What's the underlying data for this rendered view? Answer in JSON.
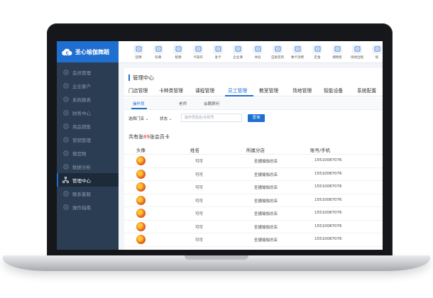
{
  "brand": {
    "name": "圣心瑜伽舞蹈"
  },
  "sidebar": {
    "items": [
      {
        "label": "会员管理",
        "icon": "user-icon",
        "active": false
      },
      {
        "label": "企业客户",
        "icon": "building-icon",
        "active": false
      },
      {
        "label": "系统报表",
        "icon": "report-icon",
        "active": false
      },
      {
        "label": "财务中心",
        "icon": "finance-icon",
        "active": false
      },
      {
        "label": "商品销售",
        "icon": "cart-icon",
        "active": false
      },
      {
        "label": "营销管理",
        "icon": "megaphone-icon",
        "active": false
      },
      {
        "label": "微官网",
        "icon": "globe-icon",
        "active": false
      },
      {
        "label": "数据分析",
        "icon": "chart-icon",
        "active": false
      },
      {
        "label": "管理中心",
        "icon": "network-icon",
        "active": true
      },
      {
        "label": "联系客服",
        "icon": "headset-icon",
        "active": false
      },
      {
        "label": "操作指南",
        "icon": "guide-icon",
        "active": false
      }
    ]
  },
  "toolbar": {
    "items": [
      {
        "label": "团课",
        "icon": "calendar-icon"
      },
      {
        "label": "私教",
        "icon": "person-icon"
      },
      {
        "label": "租课",
        "icon": "book-icon"
      },
      {
        "label": "卡操作",
        "icon": "card-icon"
      },
      {
        "label": "发卡",
        "icon": "issue-card-icon"
      },
      {
        "label": "企业课",
        "icon": "group-icon"
      },
      {
        "label": "体验",
        "icon": "experience-icon"
      },
      {
        "label": "自助签到",
        "icon": "checkin-icon"
      },
      {
        "label": "乘卡消费",
        "icon": "consume-icon"
      },
      {
        "label": "定金",
        "icon": "deposit-icon"
      },
      {
        "label": "储物柜",
        "icon": "locker-icon"
      },
      {
        "label": "场地出租",
        "icon": "venue-icon"
      },
      {
        "label": "统",
        "icon": "stats-icon"
      }
    ]
  },
  "page": {
    "title": "管理中心"
  },
  "tabs": [
    {
      "label": "门店管理",
      "active": false
    },
    {
      "label": "卡种类管理",
      "active": false
    },
    {
      "label": "课程管理",
      "active": false
    },
    {
      "label": "员工管理",
      "active": true
    },
    {
      "label": "教室管理",
      "active": false
    },
    {
      "label": "场地管理",
      "active": false
    },
    {
      "label": "智能设备",
      "active": false
    },
    {
      "label": "系统配置",
      "active": false
    }
  ],
  "subtabs": [
    {
      "label": "操作员",
      "active": true
    },
    {
      "label": "老师",
      "active": false
    },
    {
      "label": "会籍顾问",
      "active": false
    }
  ],
  "filter": {
    "store_label": "选择门店",
    "status_label": "状态",
    "search_placeholder": "操作员姓名/手机号",
    "query_label": "查询"
  },
  "summary": {
    "prefix": "共有张",
    "count": "89",
    "suffix": "张会员卡"
  },
  "table": {
    "headers": [
      "头像",
      "姓名",
      "所属分店",
      "账号/手机"
    ],
    "rows": [
      {
        "name": "可可",
        "store": "圣捷瑜伽总店",
        "account": "15510087076"
      },
      {
        "name": "可可",
        "store": "圣捷瑜伽总店",
        "account": "15510087076"
      },
      {
        "name": "可可",
        "store": "圣捷瑜伽总店",
        "account": "15510087076"
      },
      {
        "name": "可可",
        "store": "圣捷瑜伽总店",
        "account": "15510087076"
      },
      {
        "name": "可可",
        "store": "圣捷瑜伽总店",
        "account": "15510087076"
      },
      {
        "name": "可可",
        "store": "圣捷瑜伽总店",
        "account": "15510087076"
      },
      {
        "name": "可可",
        "store": "圣捷瑜伽总店",
        "account": "15510087076"
      }
    ]
  },
  "colors": {
    "accent": "#1f6fd0",
    "sidebar": "#2b3d52",
    "highlight": "#e02c2c"
  }
}
